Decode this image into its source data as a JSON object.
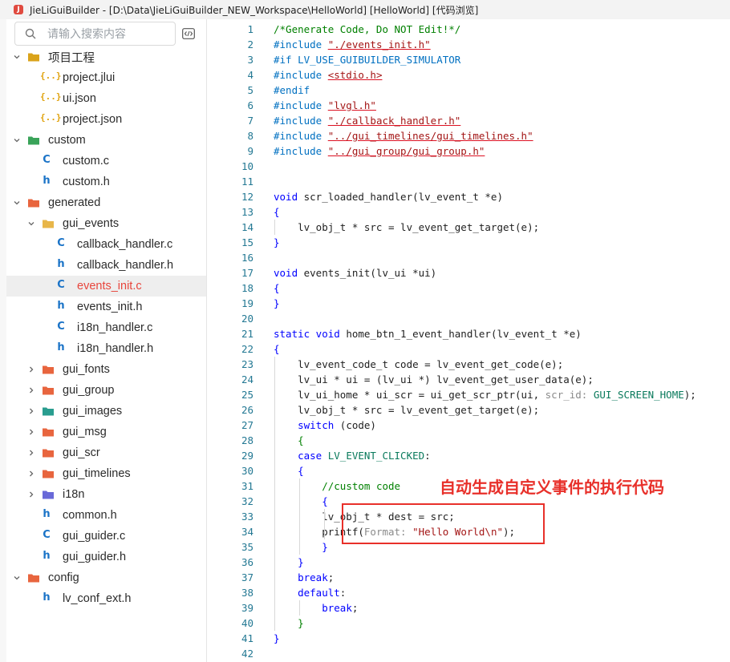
{
  "window": {
    "title": "JieLiGuiBuilder - [D:\\Data\\JieLiGuiBuilder_NEW_Workspace\\HelloWorld] [HelloWorld] [代码浏览]"
  },
  "sidebar": {
    "search_placeholder": "请输入搜索内容",
    "tree": [
      {
        "label": "项目工程",
        "depth": 0,
        "kind": "folder",
        "color": "#d9a31b",
        "expanded": true
      },
      {
        "label": "project.jlui",
        "depth": 1,
        "kind": "json"
      },
      {
        "label": "ui.json",
        "depth": 1,
        "kind": "json"
      },
      {
        "label": "project.json",
        "depth": 1,
        "kind": "json"
      },
      {
        "label": "custom",
        "depth": 0,
        "kind": "folder",
        "color": "#3aa35a",
        "expanded": true
      },
      {
        "label": "custom.c",
        "depth": 1,
        "kind": "c"
      },
      {
        "label": "custom.h",
        "depth": 1,
        "kind": "h"
      },
      {
        "label": "generated",
        "depth": 0,
        "kind": "folder",
        "color": "#e8653f",
        "expanded": true
      },
      {
        "label": "gui_events",
        "depth": 1,
        "kind": "folder",
        "color": "#e8b64a",
        "expanded": true
      },
      {
        "label": "callback_handler.c",
        "depth": 2,
        "kind": "c"
      },
      {
        "label": "callback_handler.h",
        "depth": 2,
        "kind": "h"
      },
      {
        "label": "events_init.c",
        "depth": 2,
        "kind": "c",
        "selected": true
      },
      {
        "label": "events_init.h",
        "depth": 2,
        "kind": "h"
      },
      {
        "label": "i18n_handler.c",
        "depth": 2,
        "kind": "c"
      },
      {
        "label": "i18n_handler.h",
        "depth": 2,
        "kind": "h"
      },
      {
        "label": "gui_fonts",
        "depth": 1,
        "kind": "folder",
        "color": "#e8653f",
        "expanded": false
      },
      {
        "label": "gui_group",
        "depth": 1,
        "kind": "folder",
        "color": "#e8653f",
        "expanded": false
      },
      {
        "label": "gui_images",
        "depth": 1,
        "kind": "folder",
        "color": "#2a9d8f",
        "expanded": false
      },
      {
        "label": "gui_msg",
        "depth": 1,
        "kind": "folder",
        "color": "#e8653f",
        "expanded": false
      },
      {
        "label": "gui_scr",
        "depth": 1,
        "kind": "folder",
        "color": "#e8653f",
        "expanded": false
      },
      {
        "label": "gui_timelines",
        "depth": 1,
        "kind": "folder",
        "color": "#e8653f",
        "expanded": false
      },
      {
        "label": "i18n",
        "depth": 1,
        "kind": "folder",
        "color": "#6a6ad8",
        "expanded": false
      },
      {
        "label": "common.h",
        "depth": 1,
        "kind": "h"
      },
      {
        "label": "gui_guider.c",
        "depth": 1,
        "kind": "c"
      },
      {
        "label": "gui_guider.h",
        "depth": 1,
        "kind": "h"
      },
      {
        "label": "config",
        "depth": 0,
        "kind": "folder",
        "color": "#e8653f",
        "expanded": true
      },
      {
        "label": "lv_conf_ext.h",
        "depth": 1,
        "kind": "h"
      }
    ]
  },
  "editor": {
    "lines": [
      [
        [
          "c",
          "/*Generate Code, Do NOT Edit!*/"
        ]
      ],
      [
        [
          "m",
          "#include "
        ],
        [
          "s",
          "\"./events_init.h\""
        ]
      ],
      [
        [
          "m",
          "#if LV_USE_GUIBUILDER_SIMULATOR"
        ]
      ],
      [
        [
          "m",
          "#include "
        ],
        [
          "s",
          "<stdio.h>"
        ]
      ],
      [
        [
          "m",
          "#endif"
        ]
      ],
      [
        [
          "m",
          "#include "
        ],
        [
          "s",
          "\"lvgl.h\""
        ]
      ],
      [
        [
          "m",
          "#include "
        ],
        [
          "s",
          "\"./callback_handler.h\""
        ]
      ],
      [
        [
          "m",
          "#include "
        ],
        [
          "s",
          "\"../gui_timelines/gui_timelines.h\""
        ]
      ],
      [
        [
          "m",
          "#include "
        ],
        [
          "s",
          "\"../gui_group/gui_group.h\""
        ]
      ],
      [],
      [],
      [
        [
          "k",
          "void"
        ],
        [
          "t",
          " scr_loaded_handler(lv_event_t *e)"
        ]
      ],
      [
        [
          "k",
          "{"
        ]
      ],
      [
        [
          "t",
          "    lv_obj_t * src = lv_event_get_target(e);"
        ]
      ],
      [
        [
          "k",
          "}"
        ]
      ],
      [],
      [
        [
          "k",
          "void"
        ],
        [
          "t",
          " events_init(lv_ui *ui)"
        ]
      ],
      [
        [
          "k",
          "{"
        ]
      ],
      [
        [
          "k",
          "}"
        ]
      ],
      [],
      [
        [
          "k",
          "static void"
        ],
        [
          "t",
          " home_btn_1_event_handler(lv_event_t *e)"
        ]
      ],
      [
        [
          "k",
          "{"
        ]
      ],
      [
        [
          "t",
          "    lv_event_code_t code = lv_event_get_code(e);"
        ]
      ],
      [
        [
          "t",
          "    lv_ui * ui = (lv_ui *) lv_event_get_user_data(e);"
        ]
      ],
      [
        [
          "t",
          "    lv_ui_home * ui_scr = ui_get_scr_ptr(ui, "
        ],
        [
          "h",
          "scr_id: "
        ],
        [
          "cst",
          "GUI_SCREEN_HOME"
        ],
        [
          "t",
          ");"
        ]
      ],
      [
        [
          "t",
          "    lv_obj_t * src = lv_event_get_target(e);"
        ]
      ],
      [
        [
          "t",
          "    "
        ],
        [
          "k",
          "switch"
        ],
        [
          "t",
          " (code)"
        ]
      ],
      [
        [
          "t",
          "    "
        ],
        [
          "c",
          "{"
        ]
      ],
      [
        [
          "t",
          "    "
        ],
        [
          "k",
          "case"
        ],
        [
          "t",
          " "
        ],
        [
          "cst",
          "LV_EVENT_CLICKED"
        ],
        [
          "t",
          ":"
        ]
      ],
      [
        [
          "t",
          "    "
        ],
        [
          "s2",
          "{"
        ]
      ],
      [
        [
          "t",
          "        "
        ],
        [
          "c",
          "//custom code"
        ]
      ],
      [
        [
          "t",
          "        "
        ],
        [
          "k",
          "{"
        ]
      ],
      [
        [
          "t",
          "        lv_obj_t * dest = src;"
        ]
      ],
      [
        [
          "t",
          "        printf("
        ],
        [
          "h",
          "Format: "
        ],
        [
          "sq",
          "\"Hello World\\n\""
        ],
        [
          "t",
          ");"
        ]
      ],
      [
        [
          "t",
          "        "
        ],
        [
          "k",
          "}"
        ]
      ],
      [
        [
          "t",
          "    "
        ],
        [
          "s2",
          "}"
        ]
      ],
      [
        [
          "t",
          "    "
        ],
        [
          "k",
          "break"
        ],
        [
          "t",
          ";"
        ]
      ],
      [
        [
          "t",
          "    "
        ],
        [
          "k",
          "default"
        ],
        [
          "t",
          ":"
        ]
      ],
      [
        [
          "t",
          "        "
        ],
        [
          "k",
          "break"
        ],
        [
          "t",
          ";"
        ]
      ],
      [
        [
          "t",
          "    "
        ],
        [
          "c",
          "}"
        ]
      ],
      [
        [
          "k",
          "}"
        ]
      ],
      []
    ]
  },
  "annotation": {
    "text": "自动生成自定义事件的执行代码",
    "color": "#e8302a"
  }
}
